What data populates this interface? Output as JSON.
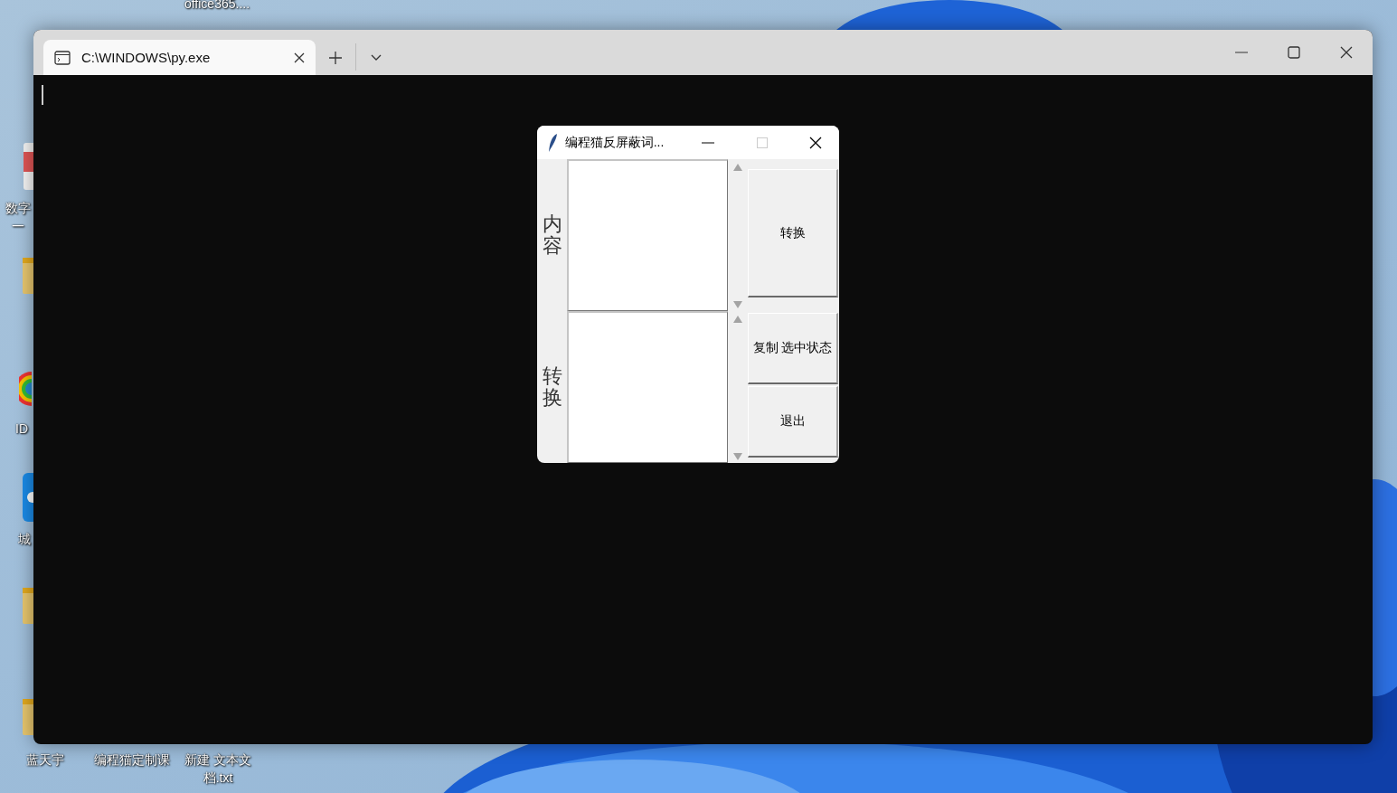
{
  "desktop": {
    "icon_labels": [
      {
        "label": "office365...."
      },
      {
        "label": "数字"
      },
      {
        "label": "一"
      },
      {
        "label": "ID"
      },
      {
        "label": "城"
      },
      {
        "label": "蓝天宇"
      },
      {
        "label": "编程猫定制课"
      },
      {
        "label": "新建 文本文档.txt"
      }
    ]
  },
  "terminal": {
    "tabs": [
      {
        "title": "C:\\WINDOWS\\py.exe",
        "selected": true
      }
    ],
    "cursor": true
  },
  "dialog": {
    "title": "编程猫反屏蔽词...",
    "panes": [
      {
        "label": "内容"
      },
      {
        "label": "转换"
      }
    ],
    "buttons": [
      "转换",
      "复制 选中状态",
      "退出"
    ]
  }
}
